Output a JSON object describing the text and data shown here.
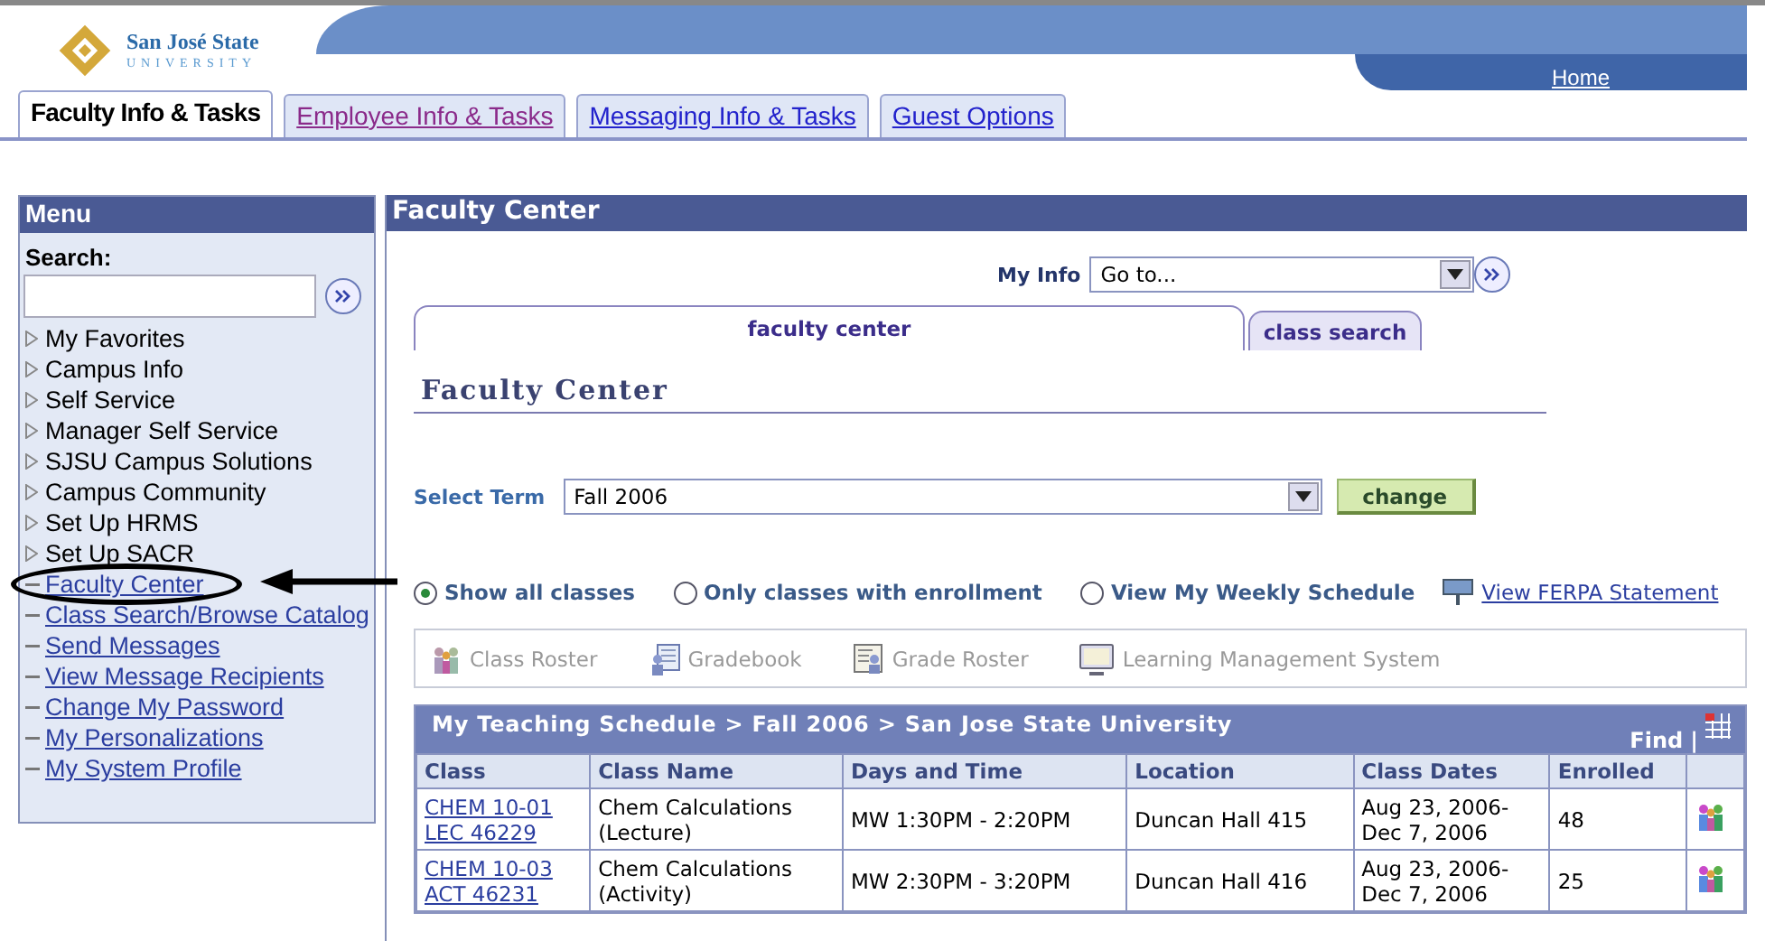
{
  "header": {
    "logo_name": "San José State",
    "logo_sub": "UNIVERSITY",
    "home_link": "Home"
  },
  "tabs": [
    {
      "label": "Faculty Info & Tasks",
      "selected": true
    },
    {
      "label": "Employee Info & Tasks",
      "selected": false,
      "visited": true
    },
    {
      "label": "Messaging Info & Tasks",
      "selected": false,
      "visited": false
    },
    {
      "label": "Guest Options",
      "selected": false,
      "visited": false
    }
  ],
  "menu": {
    "title": "Menu",
    "search_label": "Search:",
    "items": [
      {
        "label": "My Favorites",
        "kind": "folder"
      },
      {
        "label": "Campus Info",
        "kind": "folder"
      },
      {
        "label": "Self Service",
        "kind": "folder"
      },
      {
        "label": "Manager Self Service",
        "kind": "folder"
      },
      {
        "label": "SJSU Campus Solutions",
        "kind": "folder"
      },
      {
        "label": "Campus Community",
        "kind": "folder"
      },
      {
        "label": "Set Up HRMS",
        "kind": "folder"
      },
      {
        "label": "Set Up SACR",
        "kind": "folder"
      },
      {
        "label": "Faculty Center",
        "kind": "link",
        "circled": true
      },
      {
        "label": "Class Search/Browse Catalog",
        "kind": "link",
        "circled": false
      },
      {
        "label": "Send Messages",
        "kind": "link",
        "circled": false
      },
      {
        "label": "View Message Recipients",
        "kind": "link",
        "circled": false
      },
      {
        "label": "Change My Password",
        "kind": "link",
        "circled": false
      },
      {
        "label": "My Personalizations",
        "kind": "link",
        "circled": false
      },
      {
        "label": "My System Profile",
        "kind": "link",
        "circled": false
      }
    ]
  },
  "main": {
    "title": "Faculty Center",
    "my_info": {
      "label": "My Info",
      "value": "Go to..."
    },
    "page_tabs": [
      {
        "label": "faculty center",
        "selected": true
      },
      {
        "label": "class search",
        "selected": false
      }
    ],
    "heading": "Faculty Center",
    "term": {
      "label": "Select Term",
      "value": "Fall 2006",
      "button": "change"
    },
    "view_options": [
      {
        "label": "Show all classes",
        "selected": true
      },
      {
        "label": "Only classes with enrollment",
        "selected": false
      },
      {
        "label": "View My Weekly Schedule",
        "selected": false
      }
    ],
    "ferpa_link": "View FERPA Statement",
    "tools": [
      {
        "label": "Class Roster",
        "kind": "roster",
        "disabled": true
      },
      {
        "label": "Gradebook",
        "kind": "gradebook",
        "disabled": true
      },
      {
        "label": "Grade Roster",
        "kind": "graderoster",
        "disabled": true
      },
      {
        "label": "Learning Management System",
        "kind": "lms",
        "disabled": true
      }
    ],
    "schedule": {
      "title": "My Teaching Schedule > Fall 2006 > San Jose State University",
      "find": "Find",
      "separator": "|",
      "columns": [
        "Class",
        "Class Name",
        "Days and Time",
        "Location",
        "Class Dates",
        "Enrolled"
      ],
      "rows": [
        {
          "class": [
            "CHEM 10-01",
            "LEC 46229"
          ],
          "class_name": [
            "Chem Calculations",
            "(Lecture)"
          ],
          "days_time": "MW 1:30PM - 2:20PM",
          "location": "Duncan Hall 415",
          "dates": [
            "Aug 23, 2006-",
            "Dec 7, 2006"
          ],
          "enrolled": "48"
        },
        {
          "class": [
            "CHEM 10-03",
            "ACT 46231"
          ],
          "class_name": [
            "Chem Calculations",
            "(Activity)"
          ],
          "days_time": "MW 2:30PM - 3:20PM",
          "location": "Duncan Hall 416",
          "dates": [
            "Aug 23, 2006-",
            "Dec 7, 2006"
          ],
          "enrolled": "25"
        }
      ]
    }
  }
}
